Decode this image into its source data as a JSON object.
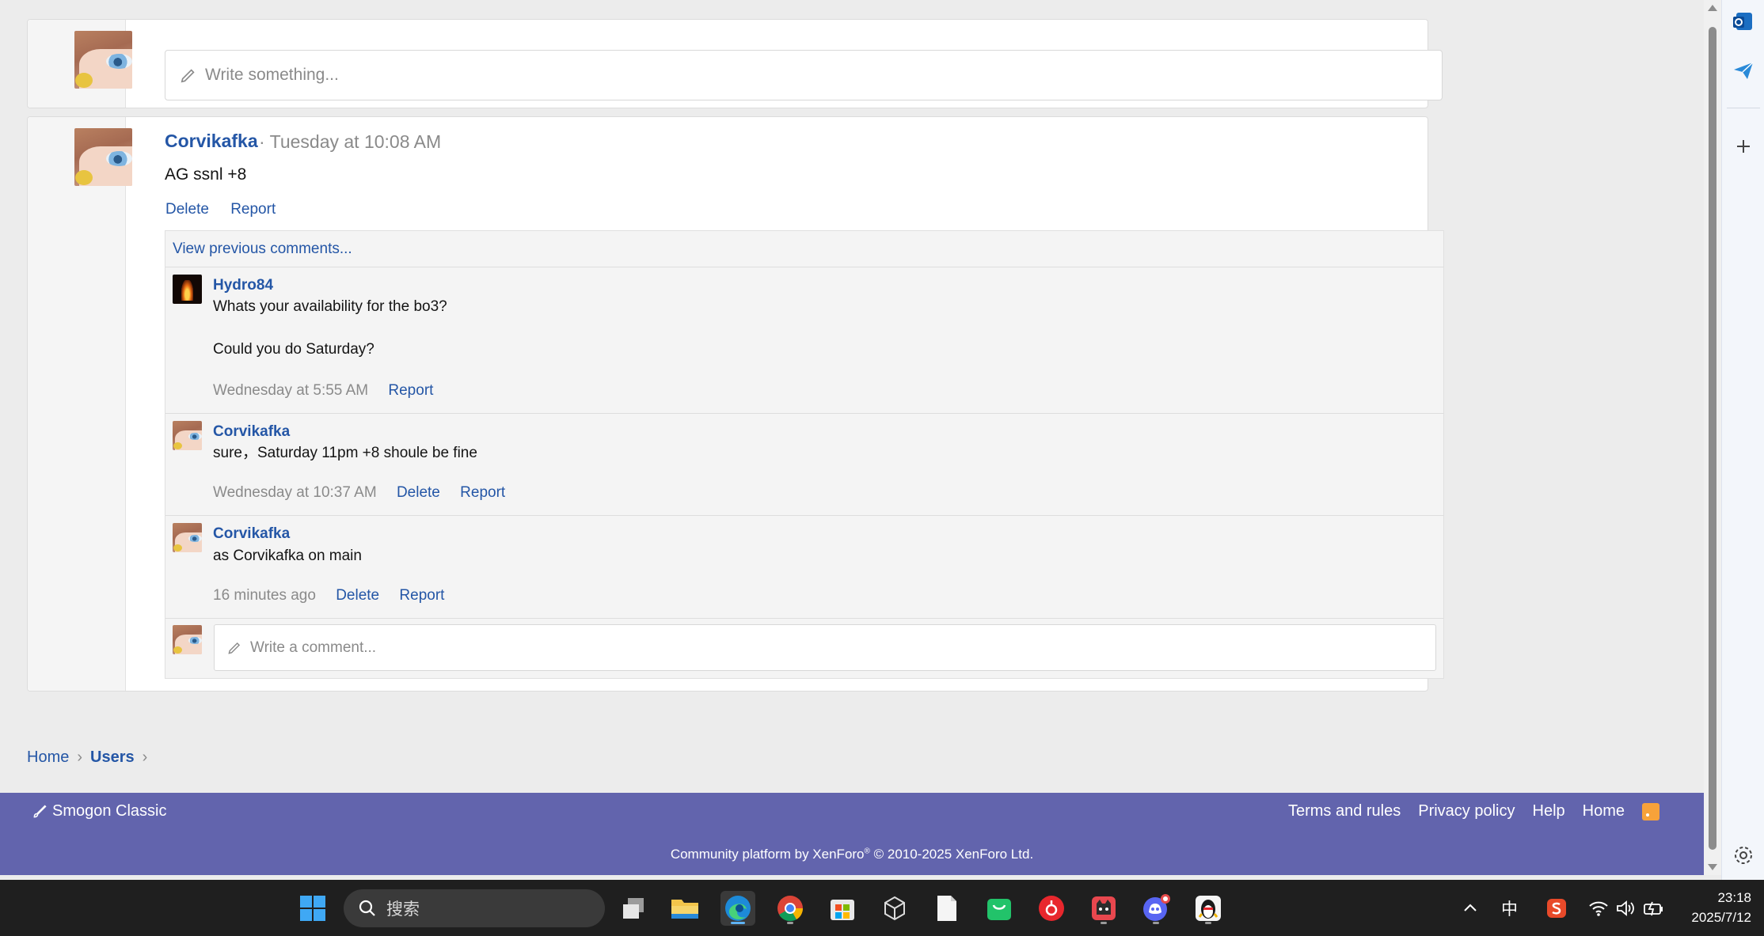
{
  "status_box": {
    "placeholder": "Write something..."
  },
  "post": {
    "author": "Corvikafka",
    "time": "· Tuesday at 10:08 AM",
    "body": "AG ssnl +8",
    "actions": [
      "Delete",
      "Report"
    ],
    "view_previous": "View previous comments...",
    "comments": [
      {
        "author": "Hydro84",
        "text": "Whats your availability for the bo3?\n\nCould you do Saturday?",
        "time": "Wednesday at 5:55 AM",
        "actions": [
          "Report"
        ]
      },
      {
        "author": "Corvikafka",
        "text": "sure，Saturday 11pm +8 shoule be fine",
        "time": "Wednesday at 10:37 AM",
        "actions": [
          "Delete",
          "Report"
        ]
      },
      {
        "author": "Corvikafka",
        "text": "as Corvikafka on main",
        "time": "16 minutes ago",
        "actions": [
          "Delete",
          "Report"
        ]
      }
    ],
    "comment_placeholder": "Write a comment..."
  },
  "breadcrumb": {
    "home": "Home",
    "users": "Users"
  },
  "footer": {
    "brand": "Smogon Classic",
    "links": [
      "Terms and rules",
      "Privacy policy",
      "Help",
      "Home"
    ],
    "copyright_prefix": "Community platform by XenForo",
    "copyright_suffix": " © 2010-2025 XenForo Ltd."
  },
  "taskbar": {
    "search_placeholder": "搜索",
    "ime": "中",
    "time": "23:18",
    "date": "2025/7/12"
  },
  "colors": {
    "link": "#2456a6",
    "footer_bg": "#6264ad",
    "taskbar_bg": "#1f1f1f"
  }
}
